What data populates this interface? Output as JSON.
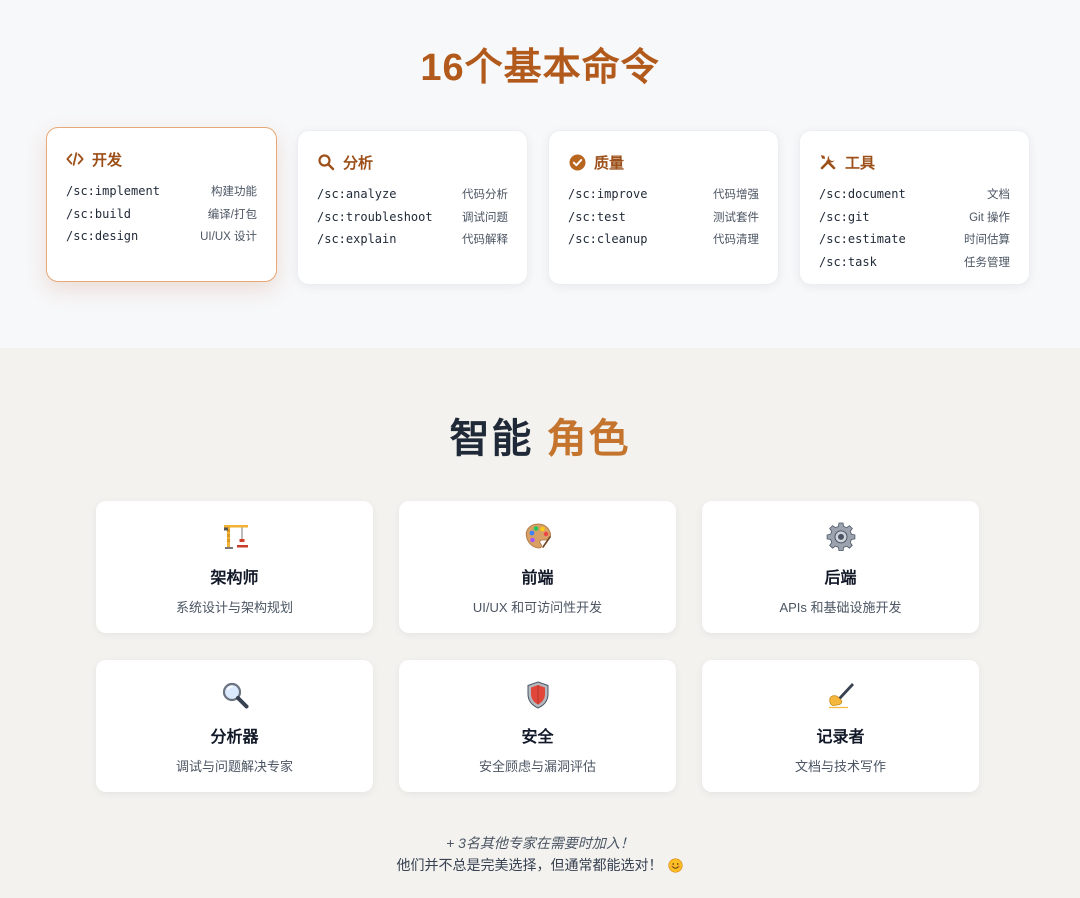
{
  "commands": {
    "title": "16个基本命令",
    "groups": [
      {
        "title": "开发",
        "icon": "code-icon",
        "items": [
          {
            "cmd": "/sc:implement",
            "desc": "构建功能"
          },
          {
            "cmd": "/sc:build",
            "desc": "编译/打包"
          },
          {
            "cmd": "/sc:design",
            "desc": "UI/UX 设计"
          }
        ]
      },
      {
        "title": "分析",
        "icon": "search-icon",
        "items": [
          {
            "cmd": "/sc:analyze",
            "desc": "代码分析"
          },
          {
            "cmd": "/sc:troubleshoot",
            "desc": "调试问题"
          },
          {
            "cmd": "/sc:explain",
            "desc": "代码解释"
          }
        ]
      },
      {
        "title": "质量",
        "icon": "check-circle-icon",
        "items": [
          {
            "cmd": "/sc:improve",
            "desc": "代码增强"
          },
          {
            "cmd": "/sc:test",
            "desc": "测试套件"
          },
          {
            "cmd": "/sc:cleanup",
            "desc": "代码清理"
          }
        ]
      },
      {
        "title": "工具",
        "icon": "tools-icon",
        "items": [
          {
            "cmd": "/sc:document",
            "desc": "文档"
          },
          {
            "cmd": "/sc:git",
            "desc": "Git 操作"
          },
          {
            "cmd": "/sc:estimate",
            "desc": "时间估算"
          },
          {
            "cmd": "/sc:task",
            "desc": "任务管理"
          }
        ]
      }
    ]
  },
  "roles": {
    "title_part1": "智能",
    "title_part2": "角色",
    "items": [
      {
        "icon": "construction-crane-icon",
        "name": "架构师",
        "desc": "系统设计与架构规划"
      },
      {
        "icon": "artist-palette-icon",
        "name": "前端",
        "desc": "UI/UX 和可访问性开发"
      },
      {
        "icon": "gear-icon",
        "name": "后端",
        "desc": "APIs 和基础设施开发"
      },
      {
        "icon": "magnifying-glass-icon",
        "name": "分析器",
        "desc": "调试与问题解决专家"
      },
      {
        "icon": "shield-icon",
        "name": "安全",
        "desc": "安全顾虑与漏洞评估"
      },
      {
        "icon": "writing-hand-icon",
        "name": "记录者",
        "desc": "文档与技术写作"
      }
    ],
    "footnote_line1": "+ 3名其他专家在需要时加入！",
    "footnote_line2": "他们并不总是完美选择，但通常都能选对！",
    "footnote_emoji": "smiling-face-icon"
  },
  "colors": {
    "accent": "#b25a1c",
    "accent_light": "#c4742c",
    "active_border": "#e6a876"
  }
}
